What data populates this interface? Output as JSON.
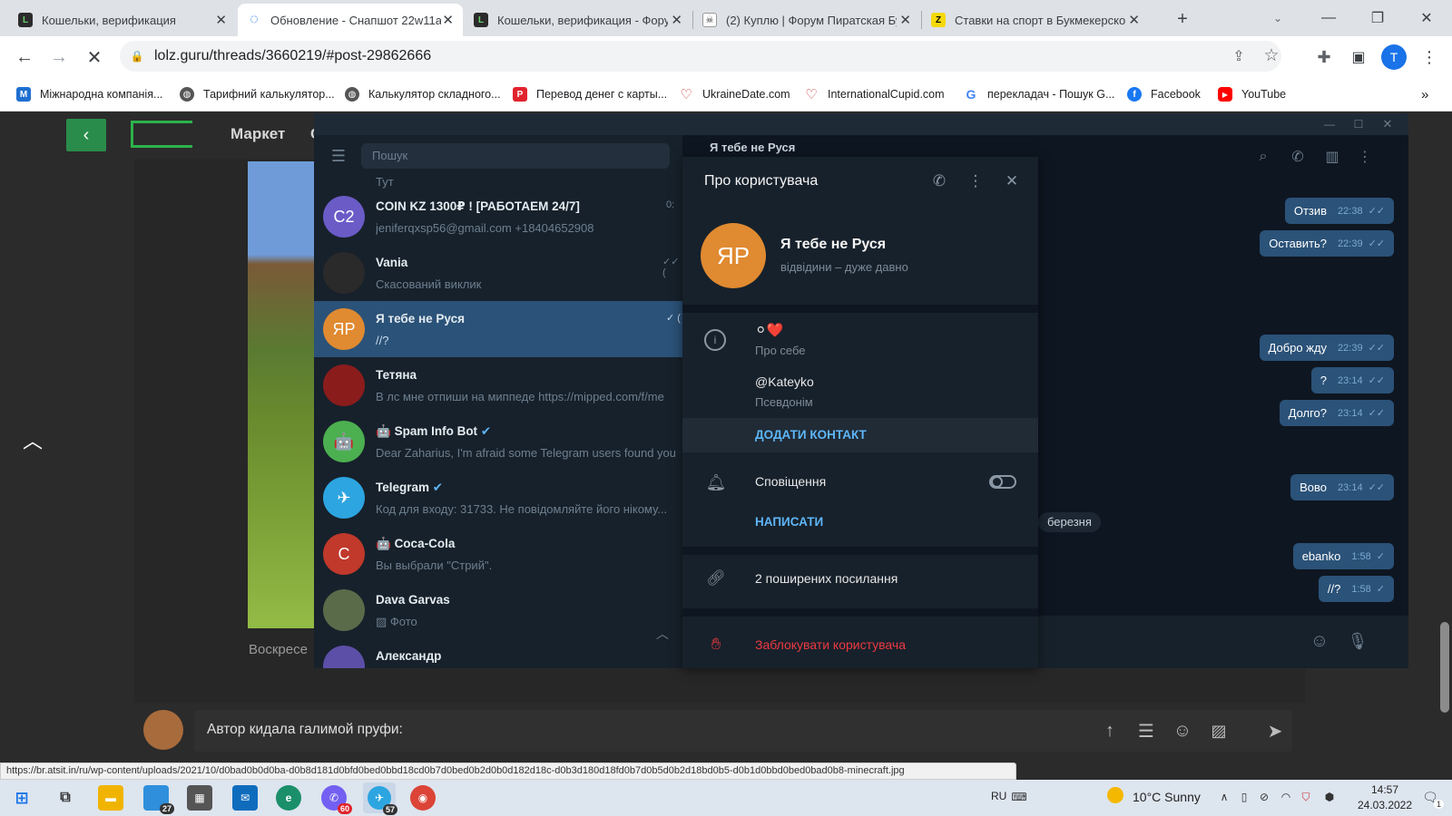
{
  "browser": {
    "tabs": [
      {
        "title": "Кошельки, верификация"
      },
      {
        "title": "Обновление - Снапшот 22w11a"
      },
      {
        "title": "Кошельки, верификация - Фору"
      },
      {
        "title": "(2) Куплю | Форум Пиратская Бу"
      },
      {
        "title": "Ставки на спорт в Букмекерско"
      }
    ],
    "url": "lolz.guru/threads/3660219/#post-29862666",
    "profile_initial": "T",
    "bookmarks": [
      {
        "label": "Міжнародна компанія..."
      },
      {
        "label": "Тарифний калькулятор..."
      },
      {
        "label": "Калькулятор складного..."
      },
      {
        "label": "Перевод денег с карты..."
      },
      {
        "label": "UkraineDate.com"
      },
      {
        "label": "InternationalCupid.com"
      },
      {
        "label": "перекладач - Пошук G..."
      },
      {
        "label": "Facebook"
      },
      {
        "label": "YouTube"
      }
    ],
    "more_bookmarks": "»"
  },
  "site": {
    "nav_market": "Маркет",
    "nav_cut": "С",
    "day_label": "Воскресе",
    "post_text": "Автор кидала галимой пруфи:",
    "status_url": "https://br.atsit.in/ru/wp-content/uploads/2021/10/d0bad0b0d0ba-d0b8d181d0bfd0bed0bbd18cd0b7d0bed0b2d0b0d182d18c-d0b3d180d18fd0b7d0b5d0b2d18bd0b5-d0b1d0bbd0bed0bad0b8-minecraft.jpg"
  },
  "telegram": {
    "search_placeholder": "Пошук",
    "chat_header_name": "Я тебе не Руся",
    "top_partial": "Тут",
    "chats": [
      {
        "name": "COIN KZ 1300₽ ! [РАБОТАЕМ 24/7]",
        "preview": "jeniferqxsp56@gmail.com        +18404652908",
        "avatar": "C2",
        "time": "0:"
      },
      {
        "name": "Vania",
        "preview": "Скасований виклик",
        "avatar": "",
        "time": "✓✓ ("
      },
      {
        "name": "Я тебе не Руся",
        "preview": "//?",
        "avatar": "ЯР",
        "time": "✓ ("
      },
      {
        "name": "Тетяна",
        "preview": "В лс мне отпиши на миппеде https://mipped.com/f/me",
        "avatar": "",
        "time": ""
      },
      {
        "name": "Spam Info Bot",
        "preview": "Dear Zaharius, I'm afraid some Telegram users found you",
        "avatar": "",
        "time": ""
      },
      {
        "name": "Telegram",
        "preview": "Код для входу: 31733. Не повідомляйте його нікому...",
        "avatar": "",
        "time": ""
      },
      {
        "name": "Coca-Cola",
        "preview": "Вы выбрали \"Стрий\".",
        "avatar": "C",
        "time": ""
      },
      {
        "name": "Dava Garvas",
        "preview": "Фото",
        "avatar": "",
        "time": ""
      },
      {
        "name": "Александр",
        "preview": "",
        "avatar": "",
        "time": ""
      }
    ],
    "messages": [
      {
        "text": "Отзив",
        "time": "22:38"
      },
      {
        "text": "Оставить?",
        "time": "22:39"
      },
      {
        "text": "Добро жду",
        "time": "22:39"
      },
      {
        "text": "?",
        "time": "23:14"
      },
      {
        "text": "Долго?",
        "time": "23:14"
      },
      {
        "text": "Вово",
        "time": "23:14"
      },
      {
        "text": "ebanko",
        "time": "1:58"
      },
      {
        "text": "//?",
        "time": "1:58"
      }
    ],
    "date_badge": "березня"
  },
  "profile": {
    "title": "Про користувача",
    "avatar_initials": "ЯР",
    "name": "Я тебе не Руся",
    "status": "відвідини – дуже давно",
    "bio": "⚪❤️",
    "bio_label": "Про себе",
    "username": "@Kateyko",
    "username_label": "Псевдонім",
    "add_contact": "ДОДАТИ КОНТАКТ",
    "notifications": "Сповіщення",
    "write": "НАПИСАТИ",
    "shared_links": "2 поширених посилання",
    "block": "Заблокувати користувача"
  },
  "taskbar": {
    "lang": "RU",
    "weather": "10°C  Sunny",
    "time": "14:57",
    "date": "24.03.2022",
    "badge_files": "27",
    "badge_viber": "60",
    "badge_telegram": "57",
    "notif_count": "1"
  },
  "colors": {
    "accent": "#5eb5f7",
    "tg_bg": "#17212b",
    "tg_chat_bg": "#0e1621",
    "bubble": "#2b5278",
    "danger": "#ec3942",
    "avatar_orange": "#e08a31"
  }
}
